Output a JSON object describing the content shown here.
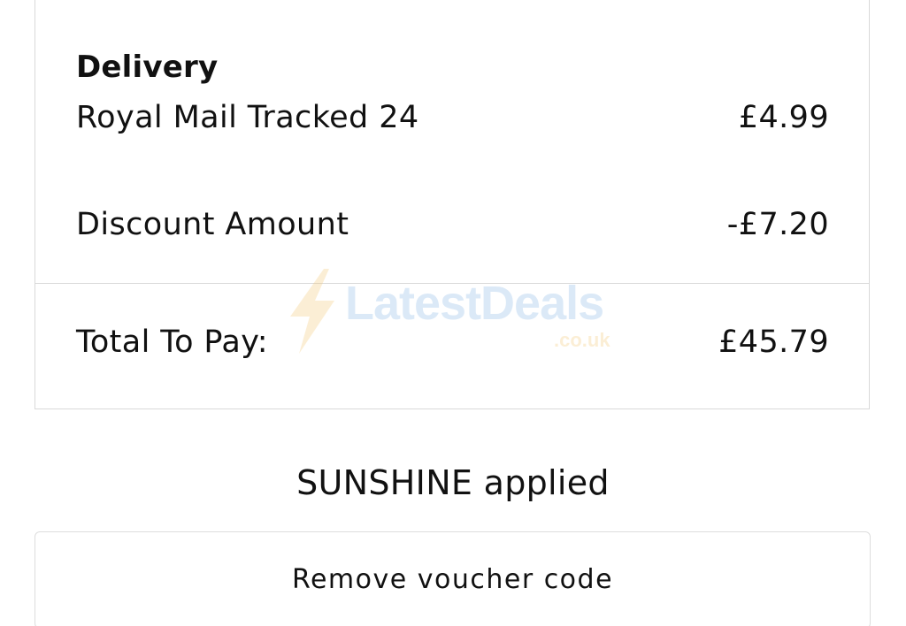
{
  "order_summary": {
    "delivery_heading": "Delivery",
    "delivery_method": "Royal Mail Tracked 24",
    "delivery_price": "£4.99",
    "discount_label": "Discount Amount",
    "discount_value": "-£7.20",
    "total_label": "Total To Pay:",
    "total_value": "£45.79"
  },
  "voucher": {
    "applied_text": "SUNSHINE applied",
    "remove_label": "Remove voucher code"
  },
  "watermark": {
    "brand": "LatestDeals",
    "domain": ".co.uk",
    "icon": "lightning-bolt-icon"
  },
  "colors": {
    "border": "#d9d9d9",
    "text": "#111111",
    "watermark_blue": "#7fb2e5",
    "watermark_yellow": "#f3c46b"
  }
}
